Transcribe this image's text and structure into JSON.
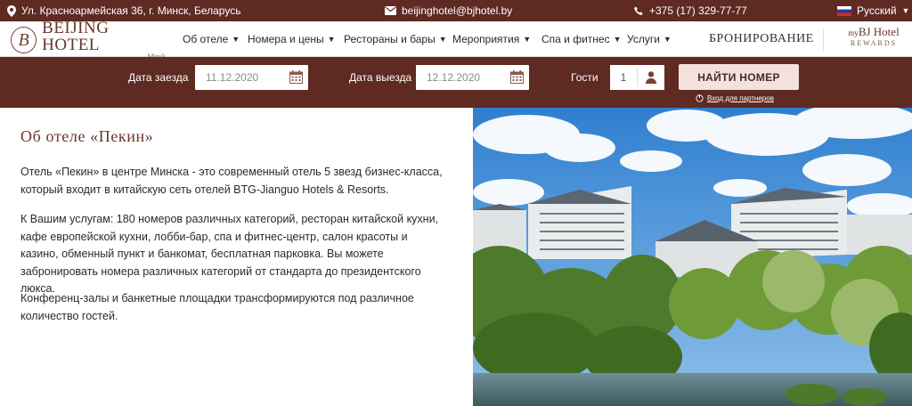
{
  "topbar": {
    "address": "Ул. Красноармейская 36, г. Минск, Беларусь",
    "email": "beijinghotel@bjhotel.by",
    "phone": "+375 (17) 329-77-77",
    "language": "Русский"
  },
  "logo": {
    "title": "BEIJING HOTEL",
    "subtitle": "Minsk",
    "mark": "B"
  },
  "nav": {
    "items": [
      {
        "label": "Об отеле"
      },
      {
        "label": "Номера и цены"
      },
      {
        "label": "Рестораны и бары"
      },
      {
        "label": "Мероприятия"
      },
      {
        "label": "Спа и фитнес"
      },
      {
        "label": "Услуги"
      }
    ],
    "booking": "БРОНИРОВАНИЕ",
    "rewards_my": "my",
    "rewards_brand": "BJ Hotel",
    "rewards_sub": "REWARDS"
  },
  "booking": {
    "checkin_label": "Дата заезда",
    "checkin_value": "11.12.2020",
    "checkout_label": "Дата выезда",
    "checkout_value": "12.12.2020",
    "guests_label": "Гости",
    "guests_value": "1",
    "find_button": "НАЙТИ НОМЕР",
    "partner_link": "Вход для партнеров"
  },
  "content": {
    "title": "Об отеле «Пекин»",
    "paragraphs": [
      "Отель «Пекин» в центре Минска - это современный отель 5 звезд бизнес-класса, который входит в китайскую сеть отелей BTG-Jianguo Hotels & Resorts.",
      "К Вашим услугам: 180 номеров различных категорий, ресторан китайской кухни, кафе европейской кухни, лобби-бар, спа и фитнес-центр, салон красоты и казино, обменный пункт и банкомат, бесплатная парковка. Вы можете забронировать номера различных категорий от стандарта до президентского люкса.",
      "Конференц-залы и банкетные площадки трансформируются под различное количество гостей."
    ]
  },
  "colors": {
    "brand": "#5e2a22",
    "accent_button": "#f3e2dc",
    "title": "#6b3429"
  }
}
